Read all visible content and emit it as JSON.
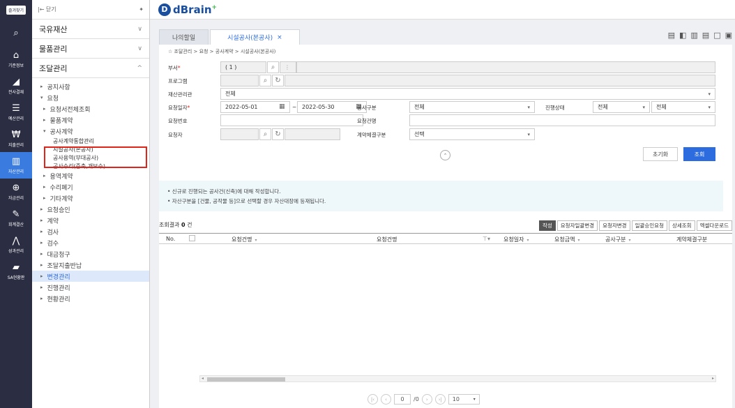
{
  "rail": {
    "fav_label": "즐겨찾기",
    "items": [
      {
        "icon": "search-icon",
        "glyph": "⌕",
        "label": ""
      },
      {
        "icon": "home-icon",
        "glyph": "⌂",
        "label": "기준정보"
      },
      {
        "icon": "compass-icon",
        "glyph": "◢",
        "label": "전사결재"
      },
      {
        "icon": "db-icon",
        "glyph": "☰",
        "label": "예산관리"
      },
      {
        "icon": "money-icon",
        "glyph": "₩",
        "label": "지출관리"
      },
      {
        "icon": "building-icon",
        "glyph": "▥",
        "label": "자산관리"
      },
      {
        "icon": "fund-icon",
        "glyph": "⊕",
        "label": "자금관리"
      },
      {
        "icon": "edit-icon",
        "glyph": "✎",
        "label": "회계결산"
      },
      {
        "icon": "chart-icon",
        "glyph": "⋀",
        "label": "성과관리"
      },
      {
        "icon": "folder-icon",
        "glyph": "▰",
        "label": "SA현황판"
      }
    ]
  },
  "sidebar": {
    "collapse_label": "|← 닫기",
    "pin_icon": "pin-icon",
    "cats": [
      {
        "label": "국유재산",
        "chev": "∨"
      },
      {
        "label": "물품관리",
        "chev": "∨"
      },
      {
        "label": "조달관리",
        "chev": "^"
      }
    ],
    "tree": [
      {
        "label": "공지사항",
        "level": "l1",
        "arrow": "▸"
      },
      {
        "label": "요청",
        "level": "l1",
        "arrow": "▾"
      },
      {
        "label": "요청서전체조회",
        "level": "l2",
        "arrow": "▸"
      },
      {
        "label": "물품계약",
        "level": "l2",
        "arrow": "▸"
      },
      {
        "label": "공사계약",
        "level": "l2",
        "arrow": "▾"
      },
      {
        "label": "공사계약통합관리",
        "level": "l4",
        "arrow": ""
      },
      {
        "label": "시설공사(본공사)",
        "level": "l4",
        "arrow": ""
      },
      {
        "label": "공사용역(부대공사)",
        "level": "l4",
        "arrow": ""
      },
      {
        "label": "공사수리(증축,개보수)",
        "level": "l4",
        "arrow": ""
      },
      {
        "label": "용역계약",
        "level": "l2",
        "arrow": "▸"
      },
      {
        "label": "수리폐기",
        "level": "l2",
        "arrow": "▸"
      },
      {
        "label": "기타계약",
        "level": "l2",
        "arrow": "▸"
      },
      {
        "label": "요청승인",
        "level": "l1",
        "arrow": "▸"
      },
      {
        "label": "계약",
        "level": "l1",
        "arrow": "▸"
      },
      {
        "label": "검사",
        "level": "l1",
        "arrow": "▸"
      },
      {
        "label": "검수",
        "level": "l1",
        "arrow": "▸"
      },
      {
        "label": "대금청구",
        "level": "l1",
        "arrow": "▸"
      },
      {
        "label": "조달지출반납",
        "level": "l1",
        "arrow": "▸"
      },
      {
        "label": "변경관리",
        "level": "l1",
        "arrow": "▸",
        "selected": true
      },
      {
        "label": "진행관리",
        "level": "l1",
        "arrow": "▸"
      },
      {
        "label": "현황관리",
        "level": "l1",
        "arrow": "▸"
      }
    ]
  },
  "header": {
    "logo_letter": "D",
    "logo_text": "dBrain",
    "logo_plus": "+"
  },
  "tabs": {
    "home": "나의할일",
    "active": "시설공사(본공사)",
    "close": "×"
  },
  "breadcrumb": "☆ 조달관리 > 요청 > 공사계약 > 시설공사(본공사)",
  "form": {
    "dept_label": "부서",
    "dept_value": "(       1    )",
    "req_mark": "*",
    "program_label": "프로그램",
    "asset_label": "재산관리관",
    "asset_value": "전체",
    "date_label": "요청일자",
    "date_from": "2022-05-01",
    "date_to": "2022-05-30",
    "date_sep": "~",
    "type_label": "공사구분",
    "type_value": "전체",
    "status_label": "진행상태",
    "status_a": "전체",
    "status_b": "전체",
    "reqno_label": "요청번호",
    "reqname_label": "요청건명",
    "requester_label": "요청자",
    "method_label": "계약체결구분",
    "method_value": "선택",
    "reset_label": "초기화",
    "search_label": "조회"
  },
  "notice": {
    "line1": "• 신규로 진행되는 공사건(신축)에 대해 작성합니다.",
    "line2": "• 자산구분을 [건물, 공작물 등]으로 선택할 경우 자산대장에 등재됩니다."
  },
  "results": {
    "label": "조회결과",
    "count": "0",
    "unit": "건"
  },
  "actions": [
    "작성",
    "요청자일괄변경",
    "요청자변경",
    "일괄승인요청",
    "상세조회",
    "엑셀다운로드"
  ],
  "columns": [
    "No.",
    "요청건명",
    "요청건명",
    "요청일자",
    "요청금액",
    "공사구분",
    "계약체결구분"
  ],
  "pager": {
    "page": "0",
    "total": "/0",
    "size": "10"
  }
}
